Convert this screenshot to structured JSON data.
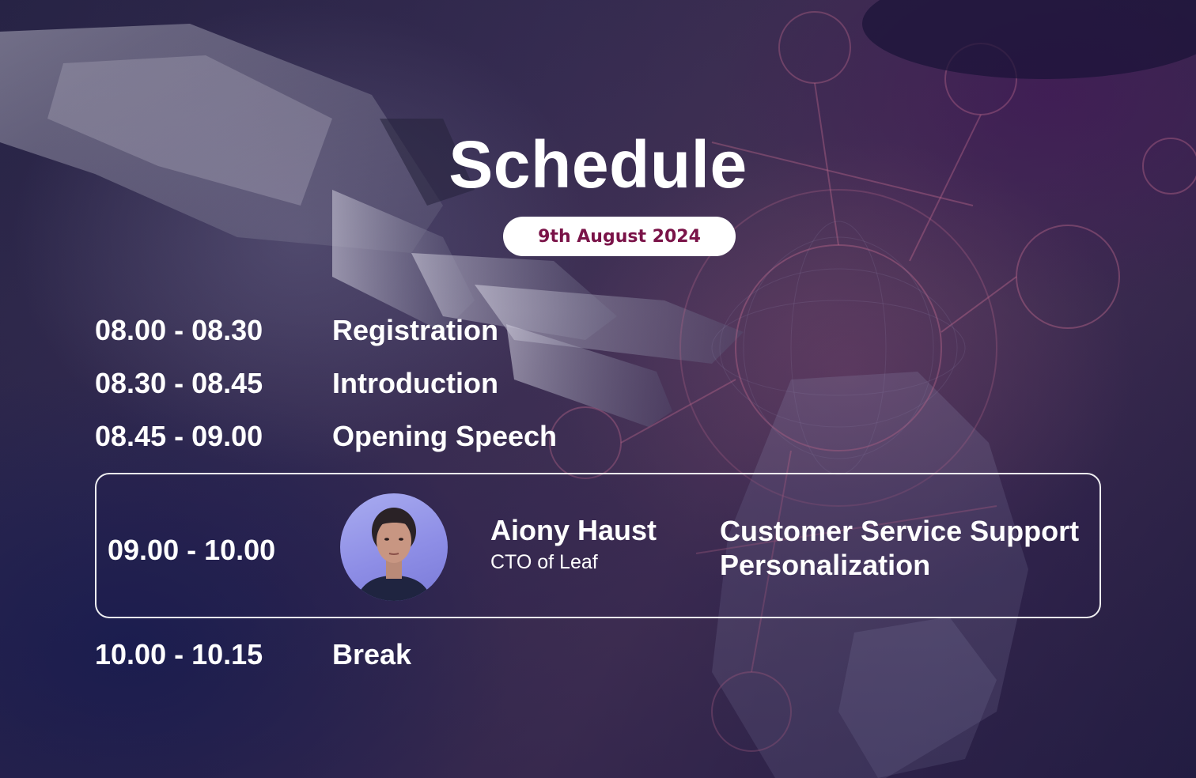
{
  "page": {
    "title": "Schedule",
    "date": "9th August 2024"
  },
  "schedule": [
    {
      "time": "08.00 - 08.30",
      "event": "Registration"
    },
    {
      "time": "08.30 - 08.45",
      "event": "Introduction"
    },
    {
      "time": "08.45 - 09.00",
      "event": "Opening Speech"
    },
    {
      "time": "10.00 - 10.15",
      "event": "Break"
    }
  ],
  "featured": {
    "time": "09.00 - 10.00",
    "speaker_name": "Aiony Haust",
    "speaker_role": "CTO of Leaf",
    "session_title": "Customer Service Support Personalization"
  },
  "colors": {
    "accent": "#7a1348",
    "text": "#ffffff",
    "background": "#1e1d44"
  }
}
